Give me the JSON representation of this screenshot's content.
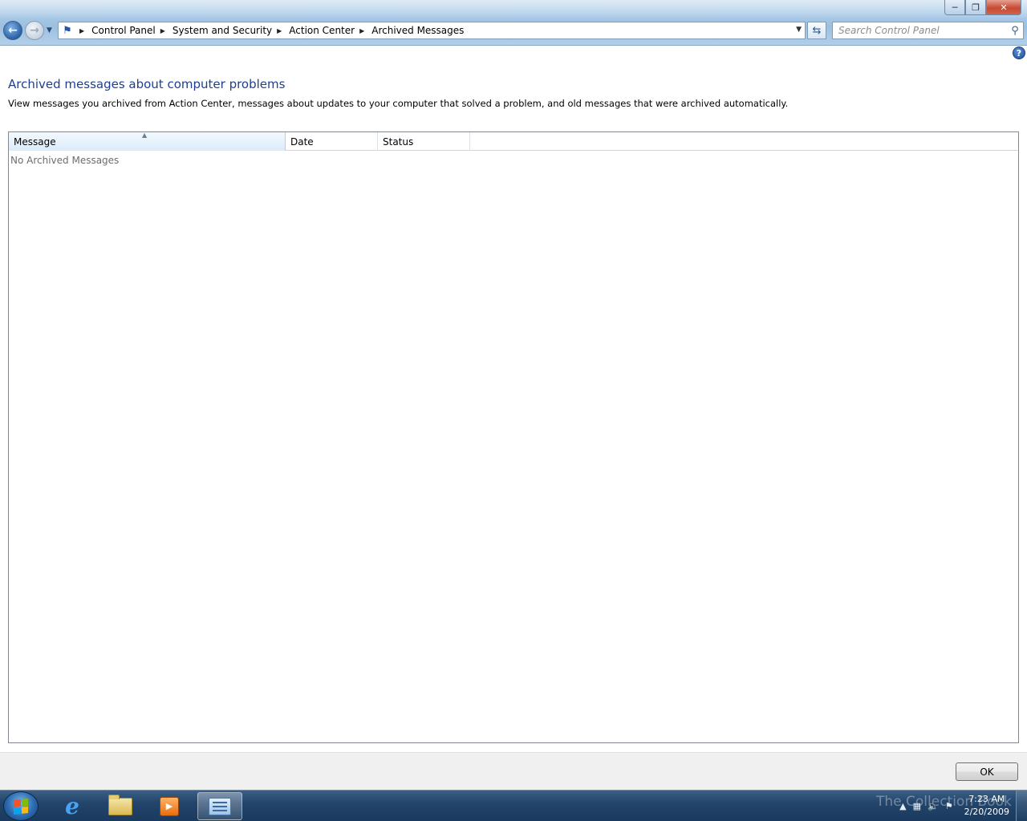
{
  "window": {
    "controls": {
      "minimize": "─",
      "maximize": "❐",
      "close": "✕"
    }
  },
  "nav": {
    "back_icon": "arrow-left-icon",
    "forward_icon": "arrow-right-icon",
    "breadcrumb": [
      "Control Panel",
      "System and Security",
      "Action Center",
      "Archived Messages"
    ],
    "search_placeholder": "Search Control Panel"
  },
  "page": {
    "title": "Archived messages about computer problems",
    "description": "View messages you archived from Action Center, messages about updates to your computer that solved a problem, and old messages that were archived automatically."
  },
  "list": {
    "columns": [
      "Message",
      "Date",
      "Status"
    ],
    "sorted_column": "Message",
    "empty_text": "No Archived Messages"
  },
  "footer": {
    "ok_label": "OK"
  },
  "taskbar": {
    "apps": [
      "internet-explorer",
      "windows-explorer",
      "windows-media-player",
      "control-panel"
    ],
    "active_app": "control-panel",
    "clock_time": "7:23 AM",
    "clock_date": "2/20/2009",
    "watermark": "The Collection Book"
  },
  "colors": {
    "title": "#1e3f8f",
    "taskbar": "#23456b"
  }
}
